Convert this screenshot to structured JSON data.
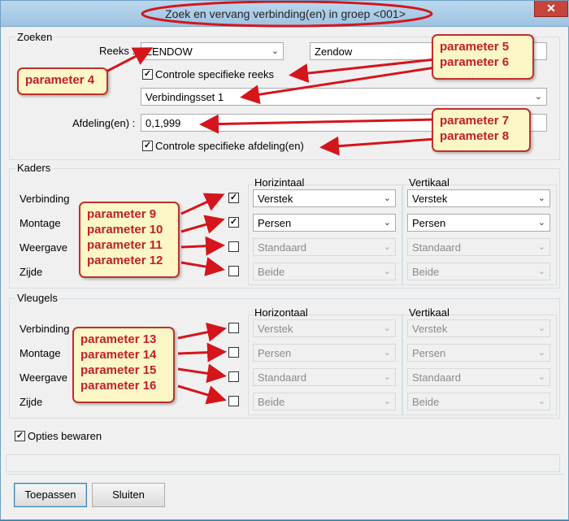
{
  "window": {
    "title": "Zoek en vervang verbinding(en) in groep <001>",
    "close_glyph": "✕"
  },
  "zoeken": {
    "label": "Zoeken",
    "reeks_label": "Reeks :",
    "reeks_value": "ZENDOW",
    "reeks_name": "Zendow",
    "controle_reeks_label": "Controle specifieke reeks",
    "controle_reeks_checked": true,
    "verbindingsset_value": "Verbindingsset 1",
    "afdeling_label": "Afdeling(en) :",
    "afdeling_value": "0,1,999",
    "controle_afdeling_label": "Controle specifieke afdeling(en)",
    "controle_afdeling_checked": true
  },
  "kaders": {
    "label": "Kaders",
    "horizontaal_label": "Horizintaal",
    "vertikaal_label": "Vertikaal",
    "rows": [
      {
        "label": "Verbinding",
        "checked": true,
        "horizontaal": "Verstek",
        "vertikaal": "Verstek",
        "enabled": true
      },
      {
        "label": "Montage",
        "checked": true,
        "horizontaal": "Persen",
        "vertikaal": "Persen",
        "enabled": true
      },
      {
        "label": "Weergave",
        "checked": false,
        "horizontaal": "Standaard",
        "vertikaal": "Standaard",
        "enabled": false
      },
      {
        "label": "Zijde",
        "checked": false,
        "horizontaal": "Beide",
        "vertikaal": "Beide",
        "enabled": false
      }
    ]
  },
  "vleugels": {
    "label": "Vleugels",
    "horizontaal_label": "Horizontaal",
    "vertikaal_label": "Vertikaal",
    "rows": [
      {
        "label": "Verbinding",
        "checked": false,
        "horizontaal": "Verstek",
        "vertikaal": "Verstek",
        "enabled": false
      },
      {
        "label": "Montage",
        "checked": false,
        "horizontaal": "Persen",
        "vertikaal": "Persen",
        "enabled": false
      },
      {
        "label": "Weergave",
        "checked": false,
        "horizontaal": "Standaard",
        "vertikaal": "Standaard",
        "enabled": false
      },
      {
        "label": "Zijde",
        "checked": false,
        "horizontaal": "Beide",
        "vertikaal": "Beide",
        "enabled": false
      }
    ]
  },
  "opties_bewaren": {
    "label": "Opties bewaren",
    "checked": true
  },
  "buttons": {
    "apply": "Toepassen",
    "close": "Sluiten"
  },
  "annotations": {
    "p4": "parameter 4",
    "p5": "parameter 5",
    "p6": "parameter 6",
    "p7": "parameter 7",
    "p8": "parameter 8",
    "p9": "parameter 9",
    "p10": "parameter 10",
    "p11": "parameter 11",
    "p12": "parameter 12",
    "p13": "parameter 13",
    "p14": "parameter 14",
    "p15": "parameter 15",
    "p16": "parameter 16"
  },
  "colors": {
    "annotation_red": "#c0202a",
    "callout_bg": "#fdf7c8",
    "titlebar": "#9cc3e2",
    "close": "#c7443a"
  }
}
